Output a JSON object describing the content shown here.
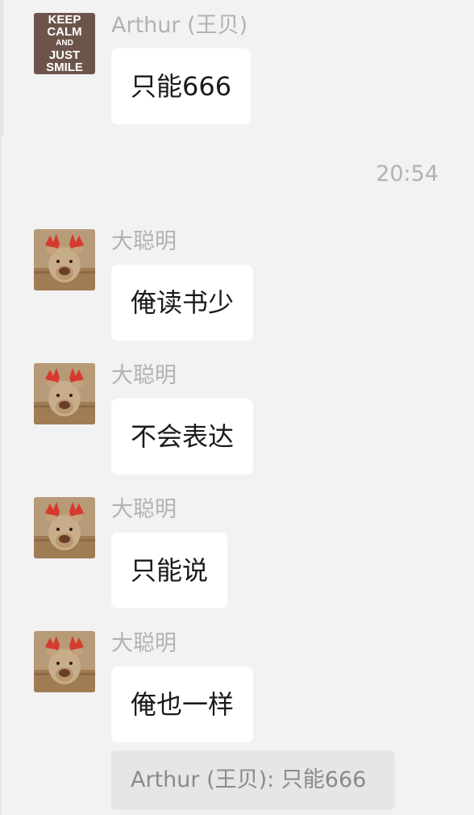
{
  "messages": [
    {
      "sender": "Arthur (王贝)",
      "text": "只能666",
      "avatar": "keep-calm-avatar"
    },
    {
      "sender": "大聪明",
      "text": "俺读书少",
      "avatar": "reindeer-avatar"
    },
    {
      "sender": "大聪明",
      "text": "不会表达",
      "avatar": "reindeer-avatar"
    },
    {
      "sender": "大聪明",
      "text": "只能说",
      "avatar": "reindeer-avatar"
    },
    {
      "sender": "大聪明",
      "text": "俺也一样",
      "avatar": "reindeer-avatar"
    }
  ],
  "timestamp": "20:54",
  "quote": {
    "text": "Arthur (王贝): 只能666"
  },
  "keep_calm": {
    "line1": "KEEP",
    "line2": "CALM",
    "line3": "AND",
    "line4": "JUST",
    "line5": "SMILE"
  },
  "colors": {
    "background": "#f2f2f2",
    "bubble": "#ffffff",
    "meta_text": "#b2b2b2",
    "quote_bg": "#e6e6e6",
    "antler_red": "#d63a2e"
  }
}
